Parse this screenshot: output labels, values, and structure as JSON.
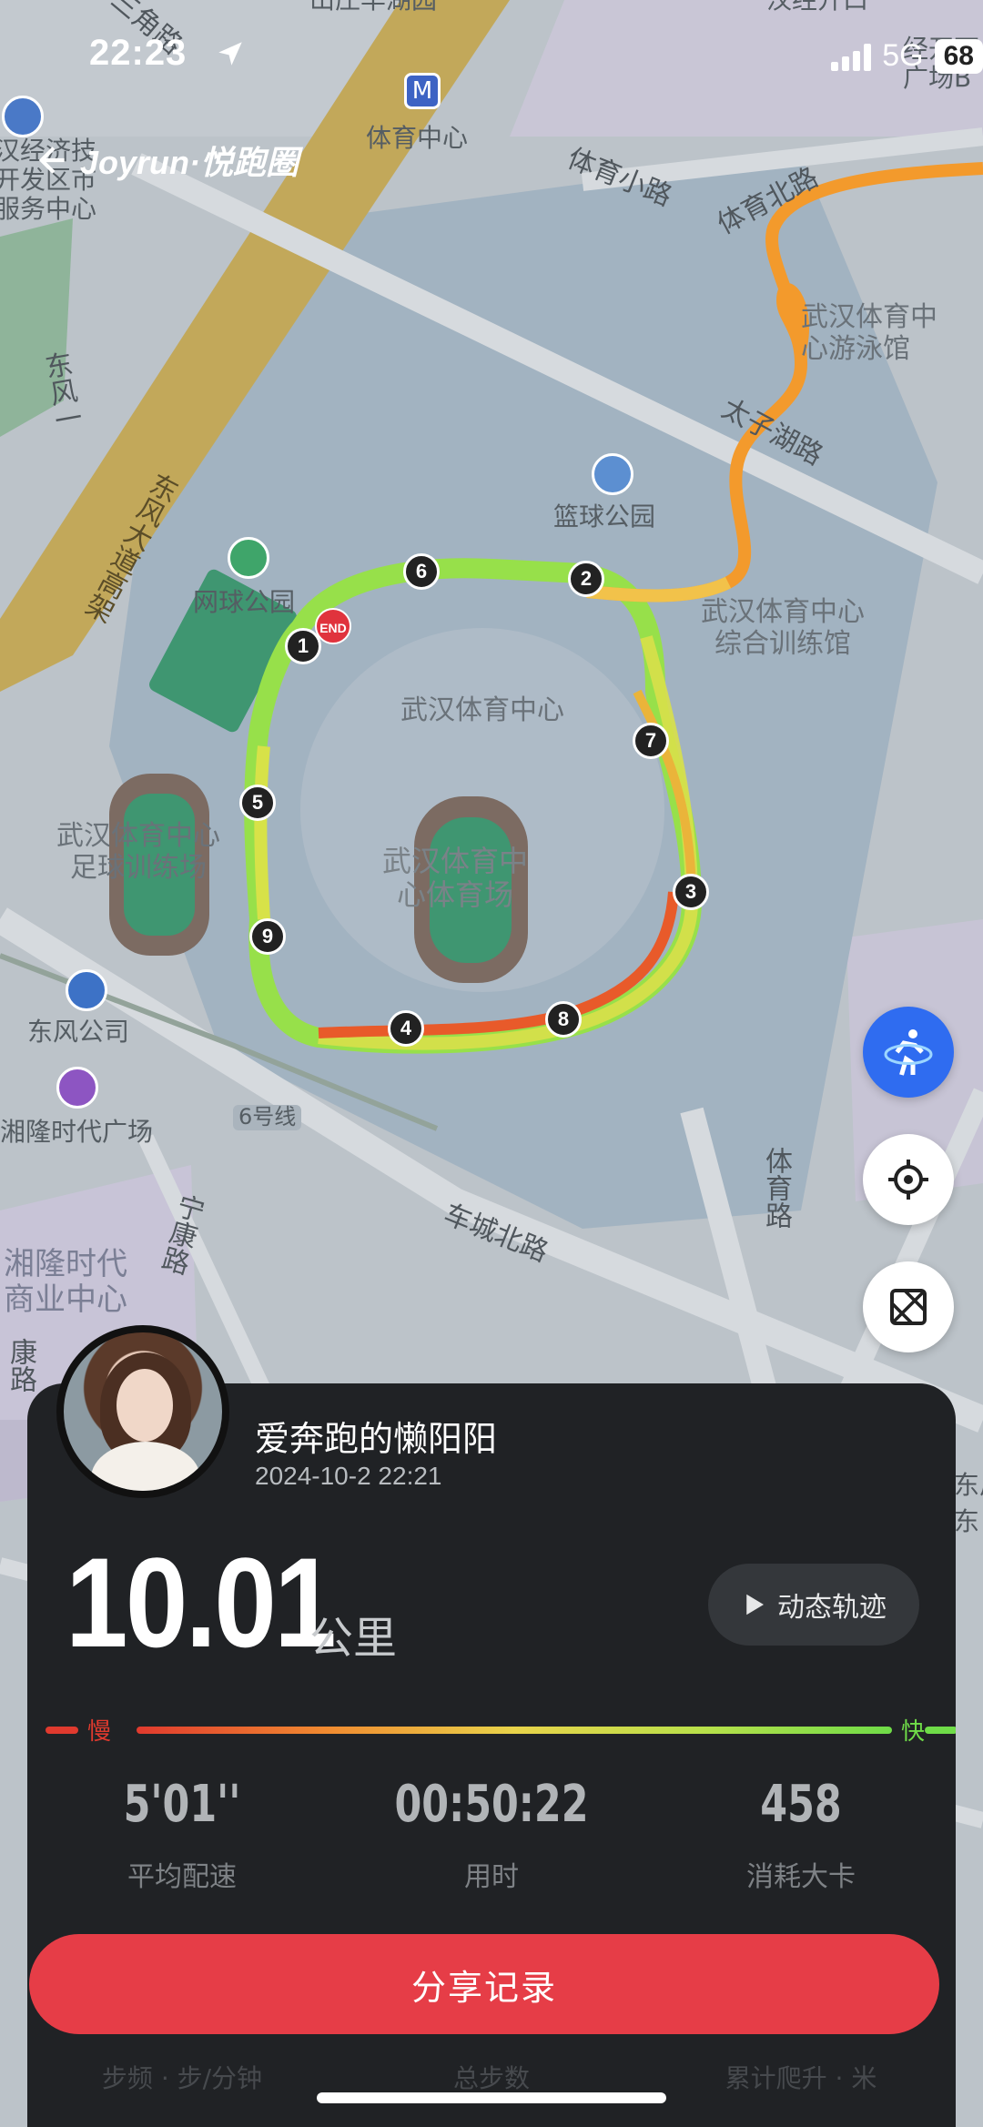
{
  "status_bar": {
    "time": "22:23",
    "network": "5G",
    "battery": "68"
  },
  "brand": {
    "name": "Joyrun·悦跑圈"
  },
  "map": {
    "labels": {
      "top_left_partial": "山庄华湖园",
      "top_right_partial": "汉经开口",
      "district": "汉经济技\n开发区市\n服务中心",
      "subway_station": "体育中心",
      "right_partial": "经开万\n广场B",
      "tiyu_xiaolu": "体育小路",
      "tiyu_beilu": "体育北路",
      "swim_hall": "武汉体育中\n心游泳馆",
      "taizi_hu_road": "太子湖路",
      "basketball_park": "篮球公园",
      "tennis_park": "网球公园",
      "training_hall": "武汉体育中心\n综合训练馆",
      "sports_center": "武汉体育中心",
      "football_training": "武汉体育中心\n足球训练场",
      "stadium": "武汉体育中\n心体育场",
      "dongfeng_company": "东风公司",
      "xianglong_plaza": "湘隆时代广场",
      "line6": "6号线",
      "checheng_beilu": "车城北路",
      "tiyu_road": "体育路",
      "ningkang_road": "宁康路",
      "xianglong_business": "湘隆时代\n商业中心",
      "dongfeng_avenue": "东风大道高架",
      "dongfeng_road": "东风一",
      "sanjiao_road": "三角路",
      "kang_road": "康路",
      "right_bottom_partial": "东风\n东",
      "end_marker": "END"
    },
    "km_markers": [
      "1",
      "2",
      "3",
      "4",
      "5",
      "6",
      "7",
      "8",
      "9"
    ]
  },
  "user": {
    "name": "爱奔跑的懒阳阳",
    "datetime": "2024-10-2 22:21"
  },
  "run": {
    "distance": "10.01",
    "distance_unit": "公里",
    "replay_label": "动态轨迹",
    "speed_slow": "慢",
    "speed_fast": "快",
    "stats": [
      {
        "value": "5'01''",
        "label": "平均配速"
      },
      {
        "value": "00:50:22",
        "label": "用时"
      },
      {
        "value": "458",
        "label": "消耗大卡"
      }
    ],
    "share_label": "分享记录",
    "secondary_stats_labels": [
      "步频 · 步/分钟",
      "总步数",
      "累计爬升 · 米"
    ]
  },
  "colors": {
    "accent_red": "#e63d47",
    "fab_blue": "#2f6cf0",
    "panel_bg": "#202225"
  }
}
